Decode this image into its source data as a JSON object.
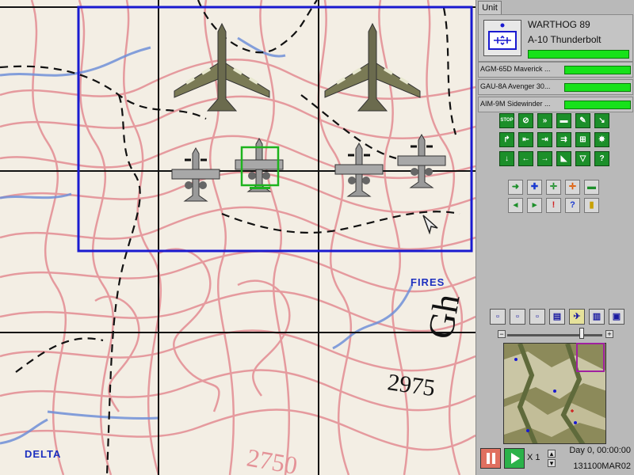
{
  "map": {
    "labels": {
      "fires": "FIRES",
      "delta": "DELTA"
    },
    "contour_numbers": [
      "2975",
      "2750"
    ],
    "colors": {
      "contour": "#e0878c",
      "river": "#6f8fd8",
      "grid": "#111111",
      "selection_box": "#1a1ad0",
      "select_frame": "#1db31d"
    }
  },
  "panel": {
    "tab_label": "Unit",
    "unit": {
      "name": "WARTHOG 89",
      "type": "A-10 Thunderbolt",
      "health": 1.0
    },
    "weapons": [
      {
        "label": "AGM-65D Maverick ...",
        "level": 1.0
      },
      {
        "label": "GAU-8A Avenger 30...",
        "level": 1.0
      },
      {
        "label": "AIM-9M Sidewinder ...",
        "level": 1.0
      }
    ],
    "order_icons": [
      "stop-icon",
      "cancel-icon",
      "fast-forward-icon",
      "mount-icon",
      "refuel-icon",
      "descend-icon",
      "turn-right-icon",
      "merge-left-icon",
      "merge-right-icon",
      "split-icon",
      "formation-icon",
      "dog-icon",
      "dismount-icon",
      "left-fire-icon",
      "right-fire-icon",
      "wedge-icon",
      "triangle-icon",
      "help-icon"
    ],
    "order_labels": [
      "STOP",
      "⊘",
      "»",
      "▬",
      "✎",
      "↘",
      "↱",
      "⇤",
      "⇥",
      "⇉",
      "⊞",
      "✸",
      "↓",
      "←",
      "→",
      "◣",
      "▽",
      "?"
    ],
    "action_labels": [
      "➜",
      "✚",
      "✛",
      "✛",
      "▬",
      "◂",
      "▸",
      "!",
      "?",
      "▮"
    ],
    "view_labels": [
      "▫",
      "▫",
      "▫",
      "▤",
      "✈",
      "▥",
      "▣"
    ],
    "speed_label": "X 1",
    "time": "Day 0, 00:00:00",
    "dtg": "131100MAR02"
  }
}
